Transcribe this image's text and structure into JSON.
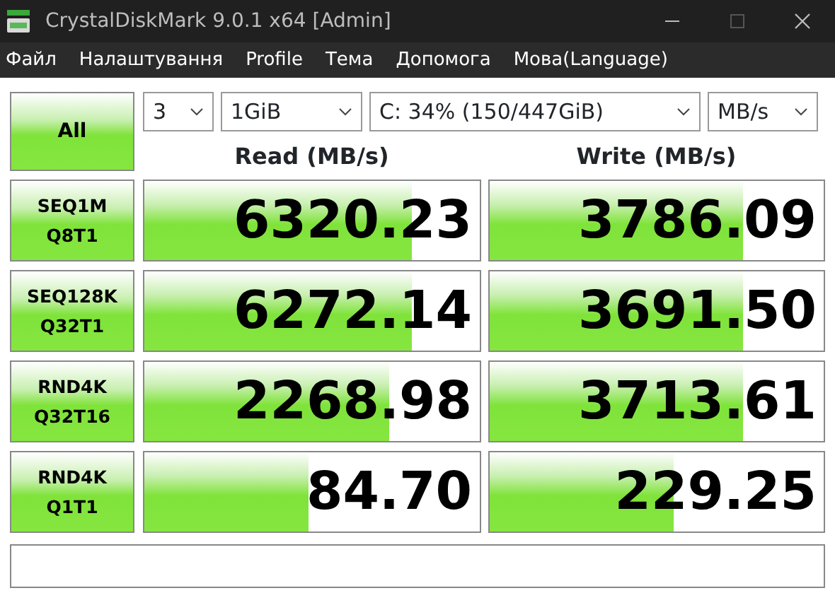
{
  "window": {
    "title": "CrystalDiskMark 9.0.1 x64 [Admin]"
  },
  "menu": [
    "Файл",
    "Налаштування",
    "Profile",
    "Тема",
    "Допомога",
    "Мова(Language)"
  ],
  "all_button": "All",
  "selects": [
    {
      "value": "3"
    },
    {
      "value": "1GiB"
    },
    {
      "value": "C: 34% (150/447GiB)"
    },
    {
      "value": "MB/s"
    }
  ],
  "columns": [
    "Read (MB/s)",
    "Write (MB/s)"
  ],
  "rows": [
    {
      "test": [
        "SEQ1M",
        "Q8T1"
      ],
      "read": {
        "value": "6320.23",
        "level": 0.8
      },
      "write": {
        "value": "3786.09",
        "level": 0.76
      }
    },
    {
      "test": [
        "SEQ128K",
        "Q32T1"
      ],
      "read": {
        "value": "6272.14",
        "level": 0.8
      },
      "write": {
        "value": "3691.50",
        "level": 0.76
      }
    },
    {
      "test": [
        "RND4K",
        "Q32T16"
      ],
      "read": {
        "value": "2268.98",
        "level": 0.73
      },
      "write": {
        "value": "3713.61",
        "level": 0.76
      }
    },
    {
      "test": [
        "RND4K",
        "Q1T1"
      ],
      "read": {
        "value": "84.70",
        "level": 0.49
      },
      "write": {
        "value": "229.25",
        "level": 0.55
      }
    }
  ]
}
